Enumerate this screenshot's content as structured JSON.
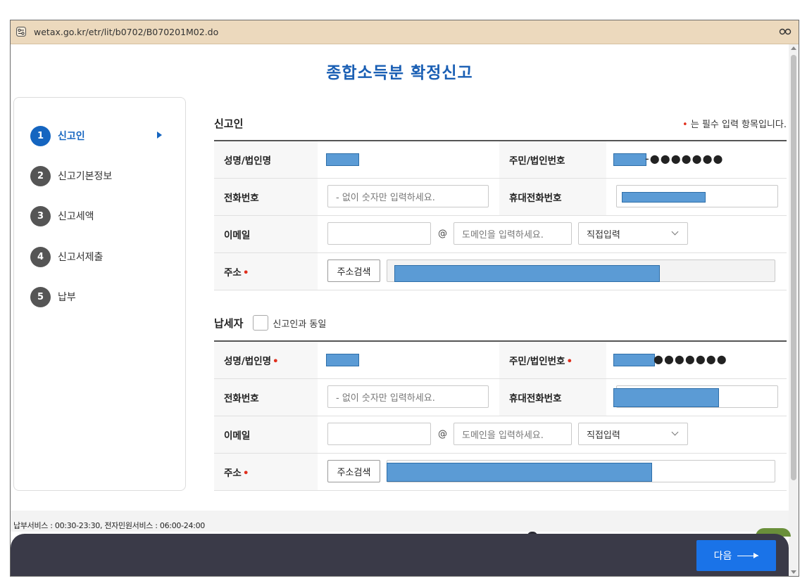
{
  "browser": {
    "url": "wetax.go.kr/etr/lit/b0702/B070201M02.do"
  },
  "page": {
    "title": "종합소득분 확정신고"
  },
  "steps": [
    {
      "num": "1",
      "label": "신고인",
      "active": true
    },
    {
      "num": "2",
      "label": "신고기본정보"
    },
    {
      "num": "3",
      "label": "신고세액"
    },
    {
      "num": "4",
      "label": "신고서제출"
    },
    {
      "num": "5",
      "label": "납부"
    }
  ],
  "reporter": {
    "heading": "신고인",
    "required_note": "는 필수 입력 항목입니다.",
    "required_dot": "•",
    "name_label": "성명/법인명",
    "id_label": "주민/법인번호",
    "id_masked_suffix": "-●●●●●●●",
    "phone_label": "전화번호",
    "phone_placeholder": "- 없이 숫자만 입력하세요.",
    "mobile_label": "휴대전화번호",
    "email_label": "이메일",
    "at": "@",
    "domain_placeholder": "도메인을 입력하세요.",
    "domain_select": "직접입력",
    "address_label": "주소",
    "address_button": "주소검색"
  },
  "taxpayer": {
    "heading": "납세자",
    "same_label": "신고인과 동일",
    "name_label": "성명/법인명",
    "id_label": "주민/법인번호",
    "id_masked_suffix": "●●●●●●●",
    "phone_label": "전화번호",
    "phone_placeholder": "- 없이 숫자만 입력하세요.",
    "mobile_label": "휴대전화번호",
    "email_label": "이메일",
    "at": "@",
    "domain_placeholder": "도메인을 입력하세요.",
    "domain_select": "직접입력",
    "address_label": "주소",
    "address_button": "주소검색"
  },
  "footer": {
    "service_hours": "납부서비스 : 00:30-23:30, 전자민원서비스 : 06:00-24:00",
    "next_label": "다음"
  },
  "colors": {
    "accent": "#1565c0",
    "required": "#e0301e",
    "redaction": "#5b9bd5",
    "bottom_bar": "#3a3a48"
  }
}
